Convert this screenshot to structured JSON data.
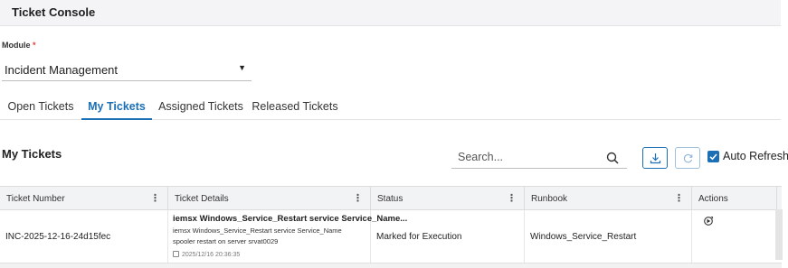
{
  "header": {
    "title": "Ticket Console"
  },
  "module": {
    "label": "Module",
    "required_mark": "*",
    "selected": "Incident Management"
  },
  "tabs": [
    {
      "label": "Open Tickets",
      "active": false
    },
    {
      "label": "My Tickets",
      "active": true
    },
    {
      "label": "Assigned Tickets",
      "active": false
    },
    {
      "label": "Released Tickets",
      "active": false
    }
  ],
  "section": {
    "title": "My Tickets"
  },
  "search": {
    "placeholder": "Search...",
    "value": ""
  },
  "toolbar": {
    "download_icon": "download-icon",
    "refresh_icon": "refresh-icon",
    "auto_refresh_label": "Auto Refresh",
    "auto_refresh_checked": true
  },
  "table": {
    "columns": [
      "Ticket Number",
      "Ticket Details",
      "Status",
      "Runbook",
      "Actions"
    ],
    "rows": [
      {
        "ticket_number": "INC-2025-12-16-24d15fec",
        "details_title": "iemsx Windows_Service_Restart service Service_Name...",
        "details_desc": "iemsx Windows_Service_Restart service Service_Name spooler restart on server srvat0029",
        "details_time": "2025/12/16 20:36:35",
        "status": "Marked for Execution",
        "runbook": "Windows_Service_Restart",
        "action_icon": "execute-icon"
      }
    ]
  },
  "colors": {
    "accent": "#1a6fb5",
    "required": "#e53935"
  }
}
